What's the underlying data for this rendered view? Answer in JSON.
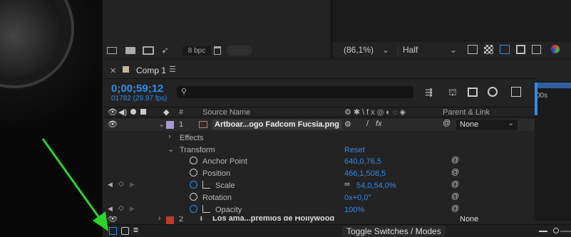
{
  "project_panel": {
    "bpc": "8 bpc"
  },
  "viewer": {
    "zoom": "(86,1%)",
    "resolution": "Half"
  },
  "comp": {
    "tab_title": "Comp 1",
    "timecode": "0;00;59;12",
    "frame_info": "01782 (29.97 fps)",
    "ruler_label": "00s"
  },
  "headers": {
    "hash": "#",
    "source_name": "Source Name",
    "parent": "Parent & Link"
  },
  "layer1": {
    "index": "1",
    "name": "Artboar...ogo Fadcom Fucsia.png",
    "parent": "None"
  },
  "groups": {
    "effects": "Effects",
    "transform": "Transform",
    "reset": "Reset"
  },
  "properties": [
    {
      "label": "Anchor Point",
      "value": "640,0,76,5"
    },
    {
      "label": "Position",
      "value": "466,1,508,5"
    },
    {
      "label": "Scale",
      "value": "54,0,54,0%"
    },
    {
      "label": "Rotation",
      "value": "0x+0,0°"
    },
    {
      "label": "Opacity",
      "value": "100%"
    }
  ],
  "layer2": {
    "index": "2",
    "name": "Los ama...premios de Hollywood",
    "parent": "None"
  },
  "status": {
    "toggle": "Toggle Switches / Modes"
  },
  "colors": {
    "accent": "#2d8ceb",
    "arrow": "#2bd42b",
    "label_l1": "#a89bd0",
    "label_l2": "#c0392b"
  }
}
